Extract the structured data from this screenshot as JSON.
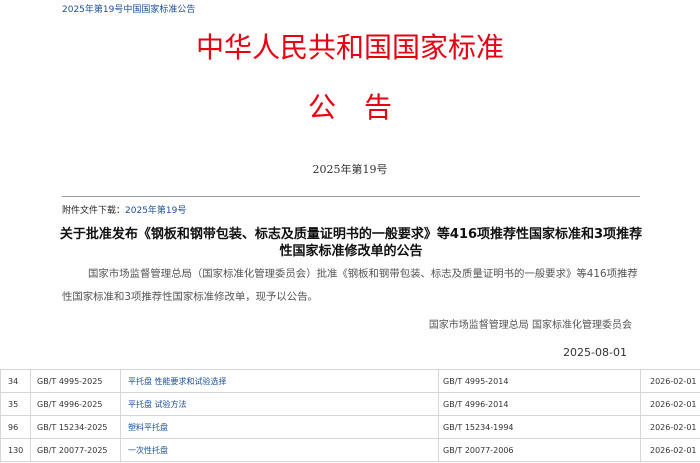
{
  "colors": {
    "title_red": "#e60012",
    "link_blue": "#1d4f9c"
  },
  "breadcrumb": {
    "link_text": "2025年第19号中国国家标准公告"
  },
  "header": {
    "title": "中华人民共和国国家标准",
    "subtitle": "公告",
    "issue_number": "2025年第19号"
  },
  "attachment": {
    "label": "附件文件下载：",
    "link_text": "2025年第19号"
  },
  "announcement": {
    "title": "关于批准发布《钢板和钢带包装、标志及质量证明书的一般要求》等416项推荐性国家标准和3项推荐性国家标准修改单的公告",
    "body": "国家市场监督管理总局（国家标准化管理委员会）批准《钢板和钢带包装、标志及质量证明书的一般要求》等416项推荐性国家标准和3项推荐性国家标准修改单，现予以公告。",
    "signature": "国家市场监督管理总局 国家标准化管理委员会",
    "date": "2025-08-01"
  },
  "table": {
    "rows": [
      {
        "no": "34",
        "code": "GB/T 4995-2025",
        "name": "平托盘 性能要求和试验选择",
        "replaces": "GB/T 4995-2014",
        "date": "2026-02-01"
      },
      {
        "no": "35",
        "code": "GB/T 4996-2025",
        "name": "平托盘 试验方法",
        "replaces": "GB/T 4996-2014",
        "date": "2026-02-01"
      },
      {
        "no": "96",
        "code": "GB/T 15234-2025",
        "name": "塑料平托盘",
        "replaces": "GB/T 15234-1994",
        "date": "2026-02-01"
      },
      {
        "no": "130",
        "code": "GB/T 20077-2025",
        "name": "一次性托盘",
        "replaces": "GB/T 20077-2006",
        "date": "2026-02-01"
      }
    ]
  }
}
